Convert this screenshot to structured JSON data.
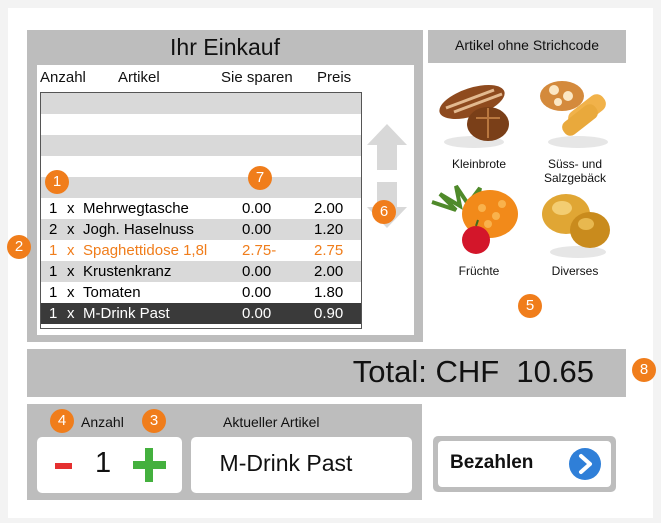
{
  "cart": {
    "title": "Ihr Einkauf",
    "columns": {
      "qty": "Anzahl",
      "item": "Artikel",
      "save": "Sie sparen",
      "price": "Preis"
    },
    "rows": [
      {
        "qty": "1",
        "x": "x",
        "name": "Mehrwegtasche",
        "save": "0.00",
        "price": "2.00"
      },
      {
        "qty": "2",
        "x": "x",
        "name": "Jogh. Haselnuss",
        "save": "0.00",
        "price": "1.20"
      },
      {
        "qty": "1",
        "x": "x",
        "name": "Spaghettidose 1,8l",
        "save": "2.75-",
        "price": "2.75"
      },
      {
        "qty": "1",
        "x": "x",
        "name": "Krustenkranz",
        "save": "0.00",
        "price": "2.00"
      },
      {
        "qty": "1",
        "x": "x",
        "name": "Tomaten",
        "save": "0.00",
        "price": "1.80"
      },
      {
        "qty": "1",
        "x": "x",
        "name": "M-Drink Past",
        "save": "0.00",
        "price": "0.90"
      }
    ]
  },
  "scroll": {
    "up_icon": "arrow-up-icon",
    "down_icon": "arrow-down-icon"
  },
  "no_barcode": {
    "title": "Artikel ohne Strichcode",
    "categories": [
      {
        "line1": "Kleinbrote",
        "line2": "",
        "icon": "bread-rolls-icon"
      },
      {
        "line1": "Süss- und",
        "line2": "Salzgebäck",
        "icon": "pastry-icon"
      },
      {
        "line1": "Früchte",
        "line2": "",
        "icon": "fruit-icon"
      },
      {
        "line1": "Diverses",
        "line2": "",
        "icon": "misc-icon"
      }
    ]
  },
  "total": {
    "text": "Total: CHF  10.65"
  },
  "quantity": {
    "label": "Anzahl",
    "value": "1",
    "minus_icon": "minus-icon",
    "plus_icon": "plus-icon"
  },
  "current_item": {
    "label": "Aktueller Artikel",
    "value": "M-Drink Past"
  },
  "pay": {
    "label": "Bezahlen",
    "icon": "chevron-right-icon"
  },
  "markers": [
    "1",
    "2",
    "3",
    "4",
    "5",
    "6",
    "7",
    "8"
  ],
  "colors": {
    "panel": "#bdbdbd",
    "accent": "#f07d1b",
    "selected_row": "#3a3a3a",
    "plus": "#44b03e",
    "minus": "#e53030",
    "pay_icon": "#2f7fd8"
  }
}
